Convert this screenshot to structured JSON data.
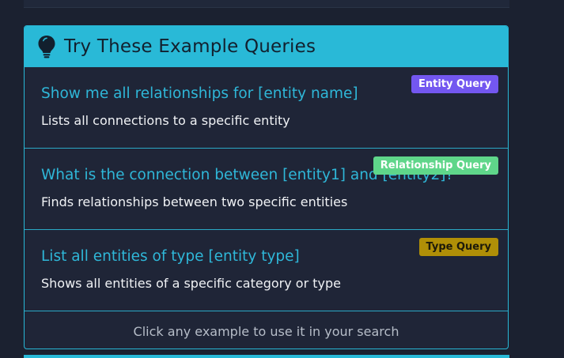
{
  "header": {
    "title": "Try These Example Queries",
    "icon": "lightbulb-icon"
  },
  "examples": [
    {
      "title": "Show me all relationships for [entity name]",
      "description": "Lists all connections to a specific entity",
      "badge": "Entity Query",
      "badge_color": "#7357f0"
    },
    {
      "title": "What is the connection between [entity1] and [entity2]?",
      "description": "Finds relationships between two specific entities",
      "badge": "Relationship Query",
      "badge_color": "#5fd68a"
    },
    {
      "title": "List all entities of type [entity type]",
      "description": "Shows all entities of a specific category or type",
      "badge": "Type Query",
      "badge_color": "#b08f07"
    }
  ],
  "footer": {
    "hint": "Click any example to use it in your search"
  },
  "colors": {
    "accent": "#29b9d7",
    "background": "#1b2130"
  }
}
